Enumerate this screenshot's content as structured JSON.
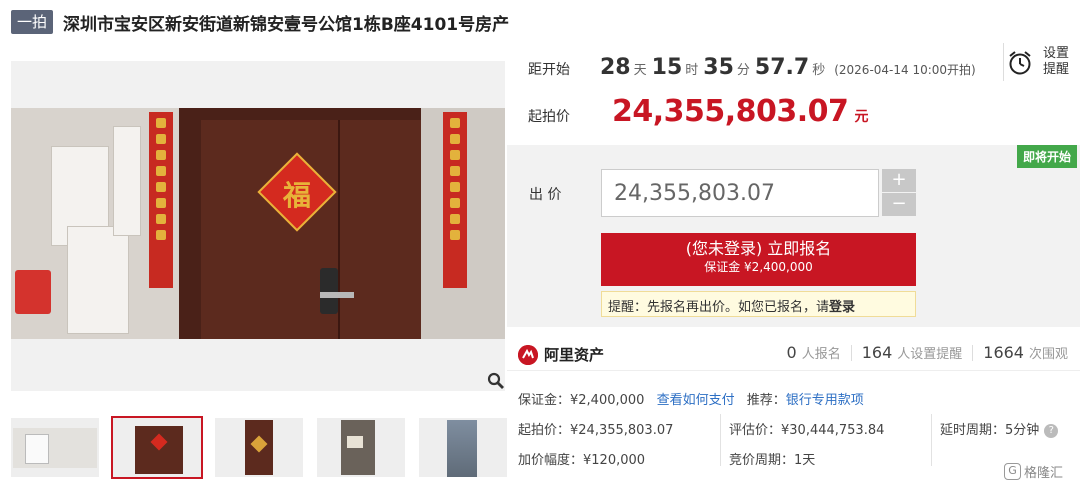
{
  "header": {
    "badge": "一拍",
    "title": "深圳市宝安区新安街道新锦安壹号公馆1栋B座4101号房产"
  },
  "countdown": {
    "label": "距开始",
    "days": "28",
    "days_unit": "天",
    "hours": "15",
    "hours_unit": "时",
    "minutes": "35",
    "minutes_unit": "分",
    "seconds": "57.7",
    "seconds_unit": "秒",
    "start_note": "(2026-04-14 10:00开拍)"
  },
  "reminder": {
    "label": "设置提醒"
  },
  "start_price": {
    "label": "起拍价",
    "value": "24,355,803.07",
    "unit": "元"
  },
  "bid_panel": {
    "status_badge": "即将开始",
    "bid_label": "出 价",
    "bid_value": "24,355,803.07",
    "plus": "+",
    "minus": "−",
    "register_line1": "(您未登录) 立即报名",
    "register_line2": "保证金 ¥2,400,000",
    "tip_text": "提醒：先报名再出价。如您已报名，请",
    "tip_login": "登录"
  },
  "platform": {
    "name": "阿里资产",
    "registered_count": "0",
    "registered_label": "人报名",
    "reminder_count": "164",
    "reminder_label": "人设置提醒",
    "watch_count": "1664",
    "watch_label": "次围观"
  },
  "details": {
    "deposit": "保证金：¥2,400,000",
    "how_to_pay": "查看如何支付",
    "recommend_label": "推荐：",
    "recommend_link": "银行专用款项",
    "start_price": "起拍价：¥24,355,803.07",
    "appraisal": "评估价：¥30,444,753.84",
    "delay_period": "延时周期：5分钟",
    "increment": "加价幅度：¥120,000",
    "bid_period": "竞价周期：1天"
  },
  "watermark": "格隆汇",
  "colors": {
    "accent": "#c81623",
    "status_green": "#43a84a",
    "link": "#2d6fc4",
    "badge": "#5b6478"
  }
}
